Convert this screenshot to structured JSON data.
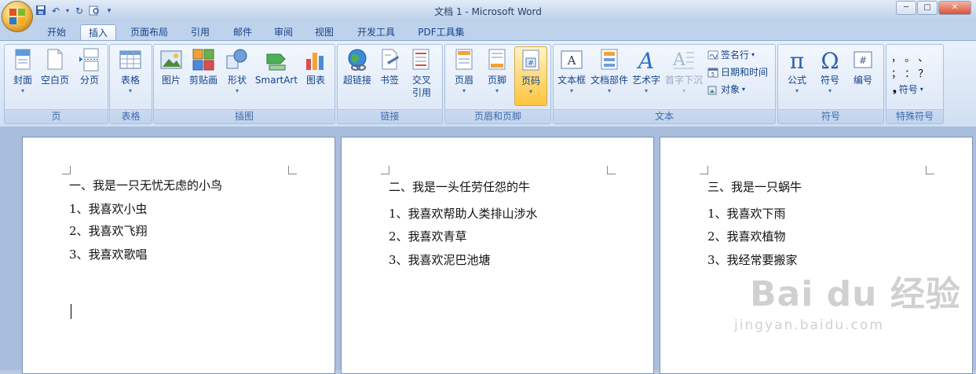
{
  "window": {
    "title": "文档 1 - Microsoft Word",
    "controls": [
      "─",
      "□",
      "✕"
    ]
  },
  "quick_access": {
    "icons": [
      "save-icon",
      "undo-icon",
      "redo-icon",
      "print-preview-icon"
    ]
  },
  "tabs": [
    {
      "label": "开始"
    },
    {
      "label": "插入"
    },
    {
      "label": "页面布局"
    },
    {
      "label": "引用"
    },
    {
      "label": "邮件"
    },
    {
      "label": "审阅"
    },
    {
      "label": "视图"
    },
    {
      "label": "开发工具"
    },
    {
      "label": "PDF工具集"
    }
  ],
  "active_tab": "插入",
  "ribbon": {
    "pages": {
      "label": "页",
      "cover": "封面",
      "blank": "空白页",
      "break": "分页"
    },
    "tables": {
      "label": "表格",
      "table": "表格"
    },
    "illustrations": {
      "label": "插图",
      "picture": "图片",
      "clipart": "剪贴画",
      "shapes": "形状",
      "smartart": "SmartArt",
      "chart": "图表"
    },
    "links": {
      "label": "链接",
      "hyperlink": "超链接",
      "bookmark": "书签",
      "crossref1": "交叉",
      "crossref2": "引用"
    },
    "header_footer": {
      "label": "页眉和页脚",
      "header": "页眉",
      "footer": "页脚",
      "page_number": "页码"
    },
    "text": {
      "label": "文本",
      "textbox": "文本框",
      "quickparts": "文档部件",
      "wordart": "艺术字",
      "dropcap": "首字下沉",
      "signature": "签名行",
      "datetime": "日期和时间",
      "object": "对象"
    },
    "symbols": {
      "label": "符号",
      "equation": "公式",
      "symbol": "符号",
      "number": "编号"
    },
    "special": {
      "label": "特殊符号",
      "row1": "，  。  、",
      "row2": "；  ：  ？",
      "symbol": "符号"
    }
  },
  "pages": [
    {
      "heading": "一、我是一只无忧无虑的小鸟",
      "items": [
        "1、我喜欢小虫",
        "2、我喜欢飞翔",
        "3、我喜欢歌唱"
      ]
    },
    {
      "heading": "二、我是一头任劳任怨的牛",
      "items": [
        "1、我喜欢帮助人类排山涉水",
        "2、我喜欢青草",
        "3、我喜欢泥巴池塘"
      ]
    },
    {
      "heading": "三、我是一只蜗牛",
      "items": [
        "1、我喜欢下雨",
        "2、我喜欢植物",
        "3、我经常要搬家"
      ]
    }
  ],
  "watermark": {
    "main": "Bai du 经验",
    "sub": "jingyan.baidu.com"
  },
  "colors": {
    "ribbon_bg": "#dbe7f6",
    "active_button": "#ffd66f",
    "doc_bg": "#a9bedc"
  }
}
